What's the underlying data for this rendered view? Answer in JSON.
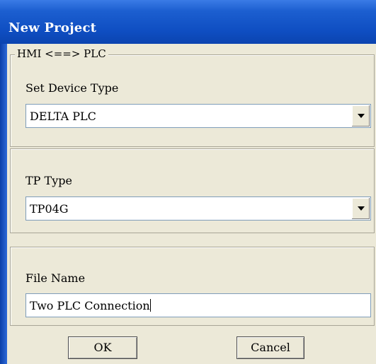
{
  "window": {
    "title": "New Project"
  },
  "connection_group": {
    "legend": "HMI <==> PLC",
    "device_type_label": "Set Device Type",
    "device_type_value": "DELTA PLC"
  },
  "tp_group": {
    "label": "TP Type",
    "value": "TP04G"
  },
  "file_group": {
    "label": "File Name",
    "value": "Two PLC Connection"
  },
  "buttons": {
    "ok": "OK",
    "cancel": "Cancel"
  },
  "colors": {
    "titlebar": "#0f4ec2",
    "window_bg": "#ece9d8",
    "input_border": "#7f9db9"
  }
}
